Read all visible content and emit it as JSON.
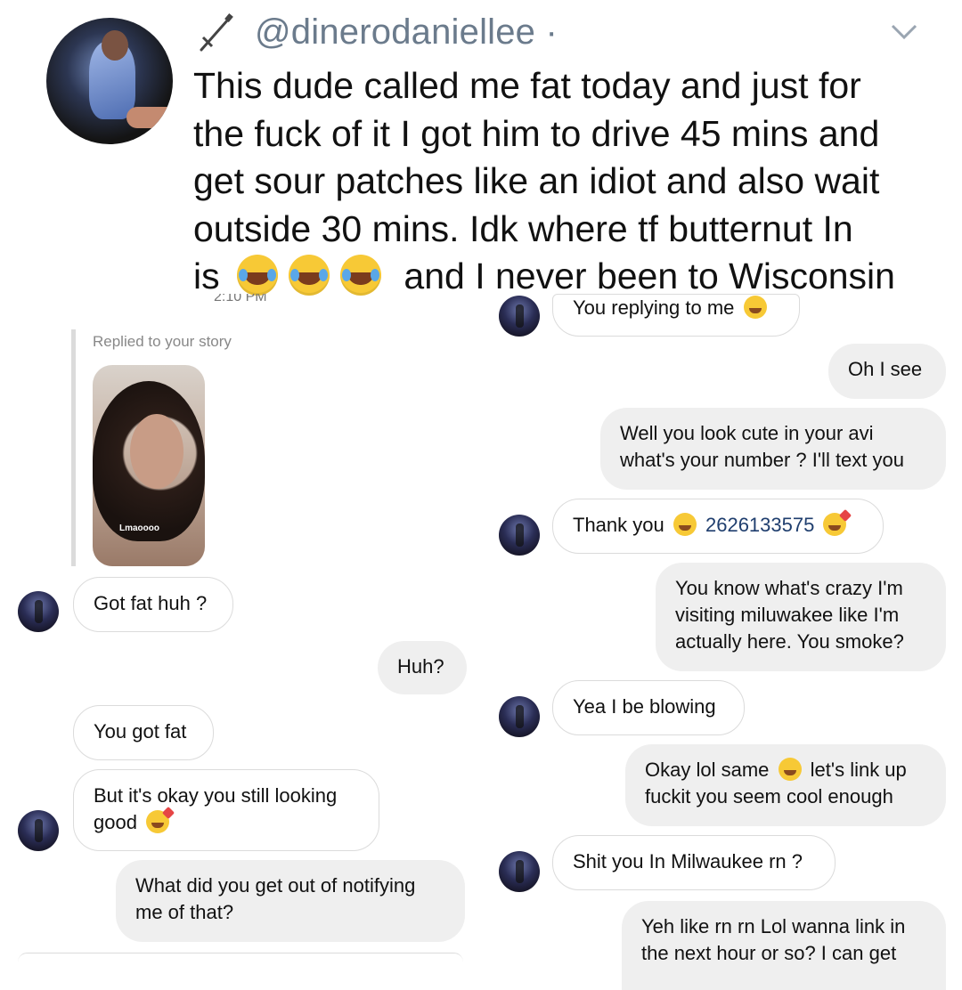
{
  "tweet": {
    "handle": "@dinerodaniellee",
    "separator": "·",
    "lines": [
      "This dude called me fat today and just for",
      "the fuck of it I got him to drive 45 mins and",
      "get sour patches like an idiot and also wait",
      "outside 30 mins. Idk where tf butternut In",
      "is",
      "and I never been to Wisconsin"
    ],
    "emojis": [
      "tears-of-joy-emoji",
      "tears-of-joy-emoji",
      "tears-of-joy-emoji"
    ],
    "cut_timestamp": "2:10 PM"
  },
  "left_chat": {
    "story_label": "Replied to your story",
    "story_caption": "Lmaoooo",
    "messages": [
      {
        "dir": "in",
        "text": "Got fat huh ?"
      },
      {
        "dir": "out",
        "text": "Huh?"
      },
      {
        "dir": "in",
        "text": "You got fat"
      },
      {
        "dir": "in",
        "text": "But it's okay you still looking",
        "text2": "good",
        "emoji": "kiss-emoji"
      },
      {
        "dir": "out",
        "text": "What did you get out of notifying",
        "text2": "me of that?"
      }
    ]
  },
  "right_chat": {
    "messages": [
      {
        "dir": "in",
        "text": "You replying to me",
        "emoji": "sweat-smile-emoji"
      },
      {
        "dir": "out",
        "text": "Oh I see"
      },
      {
        "dir": "out",
        "text": "Well you look cute in your avi",
        "text2": "what's your number ? I'll text you"
      },
      {
        "dir": "in",
        "text": "Thank you",
        "phone": "2626133575"
      },
      {
        "dir": "out",
        "text": "You know what's crazy I'm",
        "text2": "visiting miluwakee like I'm",
        "text3": "actually here. You smoke?"
      },
      {
        "dir": "in",
        "text": "Yea I be blowing"
      },
      {
        "dir": "out",
        "text": "Okay lol same",
        "text_b": "let's link up",
        "text2": "fuckit you seem cool enough"
      },
      {
        "dir": "in",
        "text": "Shit you In Milwaukee rn ?"
      },
      {
        "dir": "out",
        "text": "Yeh like rn rn Lol wanna link in",
        "text2": "the next hour or so? I can get"
      }
    ]
  }
}
